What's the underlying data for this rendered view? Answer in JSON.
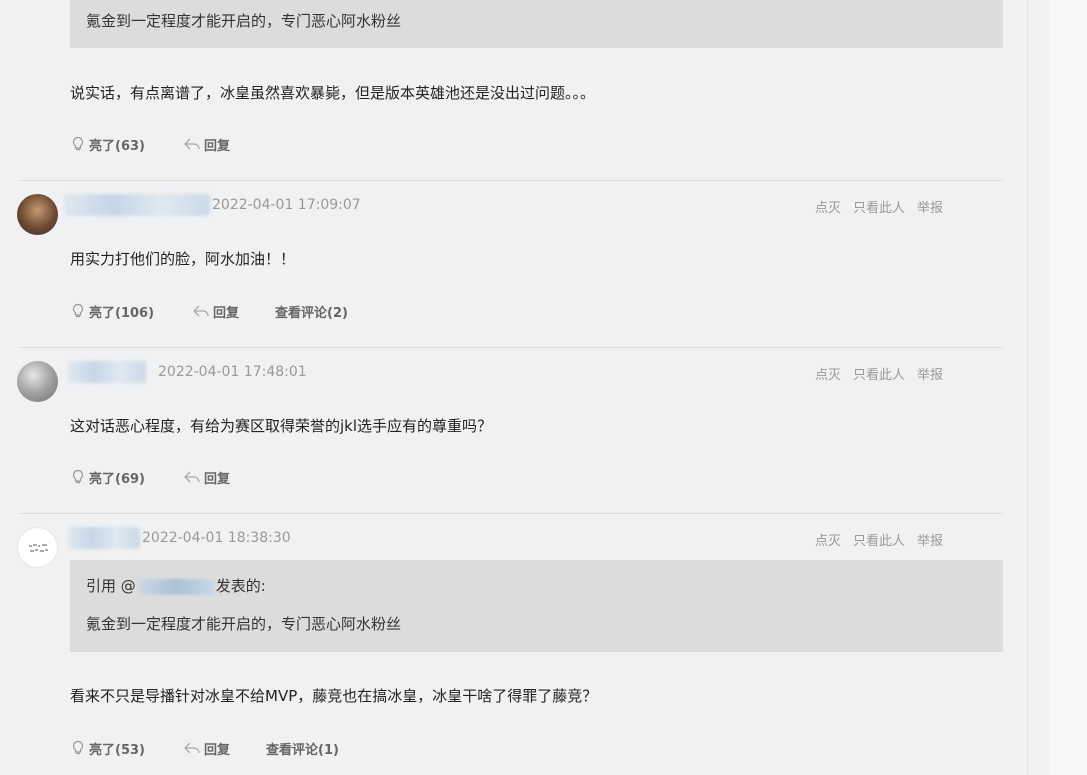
{
  "top_post": {
    "quote_text": "氪金到一定程度才能开启的，专门恶心阿水粉丝",
    "body": "说实话，有点离谱了，冰皇虽然喜欢暴毙，但是版本英雄池还是没出过问题。。。",
    "like_label": "亮了(63)",
    "reply_label": "回复"
  },
  "posts": [
    {
      "time": "2022-04-01 17:09:07",
      "tools": [
        "点灭",
        "只看此人",
        "举报"
      ],
      "body": "用实力打他们的脸，阿水加油！！",
      "like_label": "亮了(106)",
      "reply_label": "回复",
      "comments_label": "查看评论(2)"
    },
    {
      "time": "2022-04-01 17:48:01",
      "tools": [
        "点灭",
        "只看此人",
        "举报"
      ],
      "body": "这对话恶心程度，有给为赛区取得荣誉的jkl选手应有的尊重吗？",
      "like_label": "亮了(69)",
      "reply_label": "回复"
    },
    {
      "time": "2022-04-01 18:38:30",
      "tools": [
        "点灭",
        "只看此人",
        "举报"
      ],
      "quote_prefix": "引用 @",
      "quote_suffix": "发表的:",
      "quote_text": "氪金到一定程度才能开启的，专门恶心阿水粉丝",
      "body": "看来不只是导播针对冰皇不给MVP，藤竞也在搞冰皇，冰皇干啥了得罪了藤竞？",
      "like_label": "亮了(53)",
      "reply_label": "回复",
      "comments_label": "查看评论(1)"
    }
  ],
  "icons": {
    "like": "lightbulb-icon",
    "reply": "reply-arrow-icon"
  }
}
